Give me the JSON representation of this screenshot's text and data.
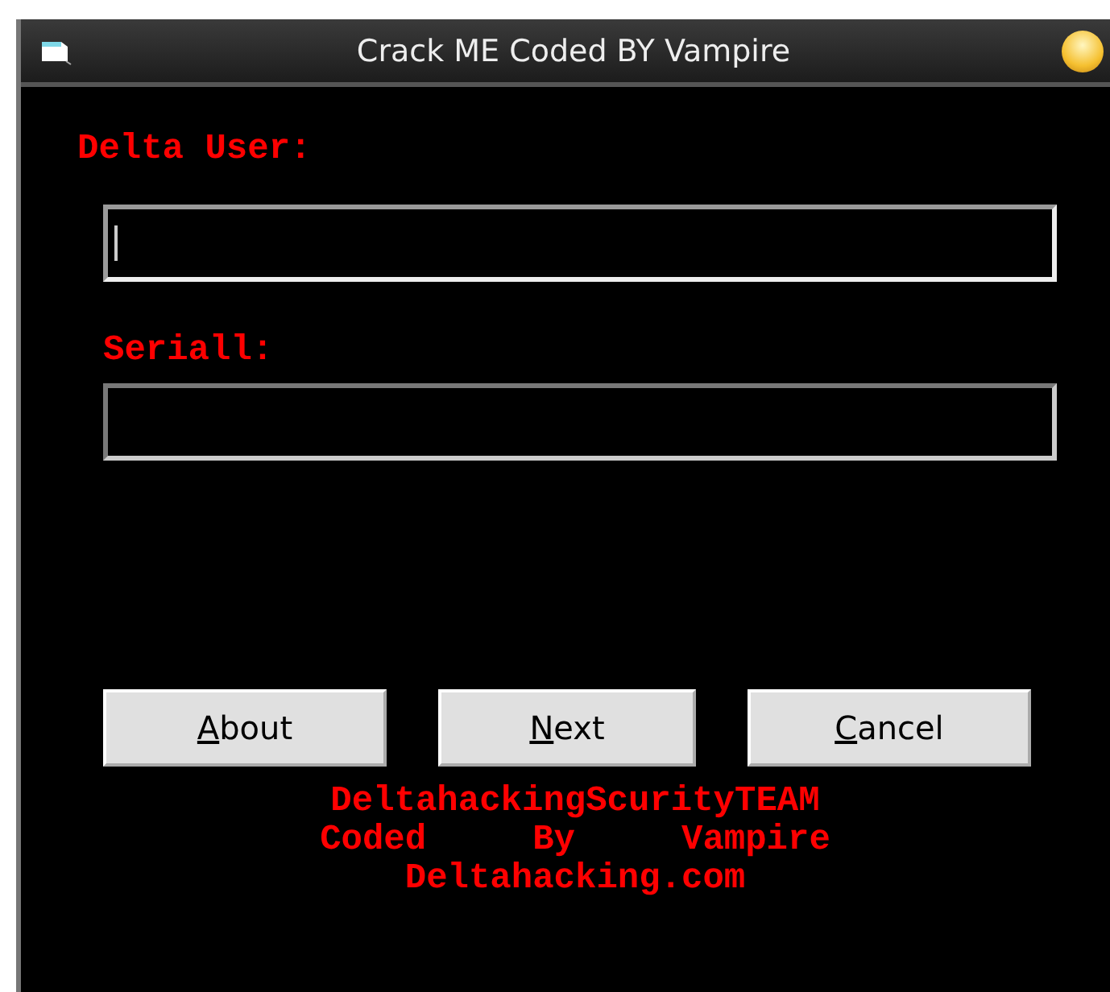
{
  "window": {
    "title": "Crack ME Coded BY Vampire"
  },
  "fields": [
    {
      "label": "Delta User:",
      "focused": true
    },
    {
      "label": "Seriall:",
      "focused": false
    }
  ],
  "buttons": [
    {
      "access_key": "A",
      "rest": "bout"
    },
    {
      "access_key": "N",
      "rest": "ext"
    },
    {
      "access_key": "C",
      "rest": "ancel"
    }
  ],
  "credits": [
    "DeltahackingScurityTEAM",
    "Coded     By     Vampire",
    "Deltahacking.com"
  ]
}
